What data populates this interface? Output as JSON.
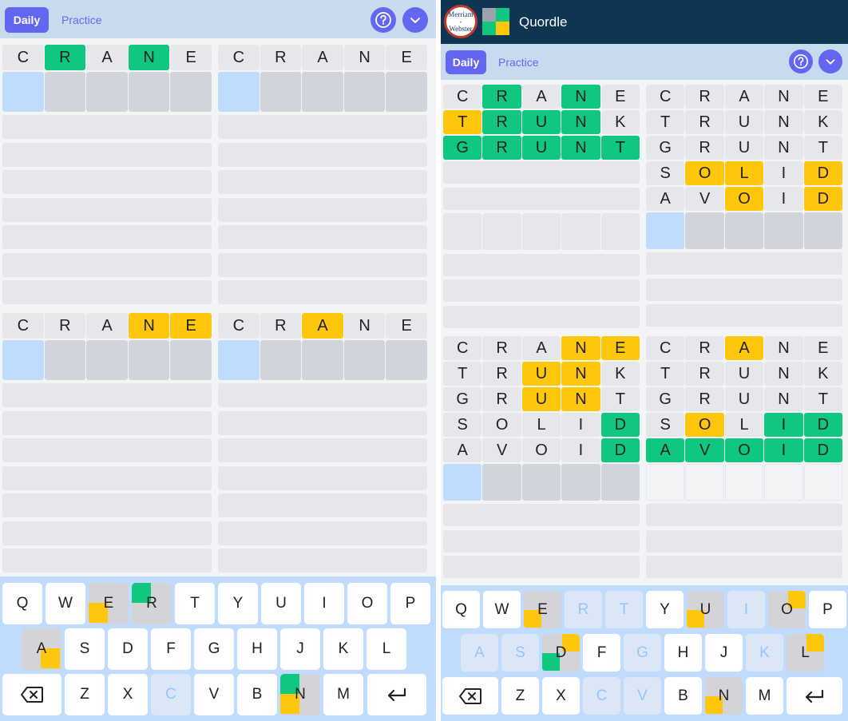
{
  "app": {
    "title": "Quordle",
    "logo_text": "Merriam-Webster"
  },
  "toolbar": {
    "daily_label": "Daily",
    "practice_label": "Practice"
  },
  "icons": {
    "help": "help-circle-icon",
    "menu": "chevron-down-icon",
    "backspace": "backspace-icon",
    "enter": "enter-arrow-icon"
  },
  "colors": {
    "green": "#10c77f",
    "yellow": "#ffc70c",
    "accent": "#6366f1",
    "header": "#0e3552"
  },
  "left": {
    "boards": [
      {
        "rows": [
          {
            "letters": [
              "C",
              "R",
              "A",
              "N",
              "E"
            ],
            "states": [
              "g",
              "G",
              "g",
              "G",
              "g"
            ]
          }
        ]
      },
      {
        "rows": [
          {
            "letters": [
              "C",
              "R",
              "A",
              "N",
              "E"
            ],
            "states": [
              "g",
              "g",
              "g",
              "g",
              "g"
            ]
          }
        ]
      },
      {
        "rows": [
          {
            "letters": [
              "C",
              "R",
              "A",
              "N",
              "E"
            ],
            "states": [
              "g",
              "g",
              "g",
              "Y",
              "Y"
            ]
          }
        ]
      },
      {
        "rows": [
          {
            "letters": [
              "C",
              "R",
              "A",
              "N",
              "E"
            ],
            "states": [
              "g",
              "g",
              "Y",
              "g",
              "g"
            ]
          }
        ]
      }
    ],
    "keyboard": {
      "row1": [
        "Q",
        "W",
        "E",
        "R",
        "T",
        "Y",
        "U",
        "I",
        "O",
        "P"
      ],
      "row2": [
        "A",
        "S",
        "D",
        "F",
        "G",
        "H",
        "J",
        "K",
        "L"
      ],
      "row3": [
        "Z",
        "X",
        "C",
        "V",
        "B",
        "N",
        "M"
      ]
    }
  },
  "right": {
    "boards": [
      {
        "rows": [
          {
            "letters": [
              "C",
              "R",
              "A",
              "N",
              "E"
            ],
            "states": [
              "g",
              "G",
              "g",
              "G",
              "g"
            ]
          },
          {
            "letters": [
              "T",
              "R",
              "U",
              "N",
              "K"
            ],
            "states": [
              "Y",
              "G",
              "G",
              "G",
              "g"
            ]
          },
          {
            "letters": [
              "G",
              "R",
              "U",
              "N",
              "T"
            ],
            "states": [
              "G",
              "G",
              "G",
              "G",
              "G"
            ]
          }
        ],
        "solved": true
      },
      {
        "rows": [
          {
            "letters": [
              "C",
              "R",
              "A",
              "N",
              "E"
            ],
            "states": [
              "g",
              "g",
              "g",
              "g",
              "g"
            ]
          },
          {
            "letters": [
              "T",
              "R",
              "U",
              "N",
              "K"
            ],
            "states": [
              "g",
              "g",
              "g",
              "g",
              "g"
            ]
          },
          {
            "letters": [
              "G",
              "R",
              "U",
              "N",
              "T"
            ],
            "states": [
              "g",
              "g",
              "g",
              "g",
              "g"
            ]
          },
          {
            "letters": [
              "S",
              "O",
              "L",
              "I",
              "D"
            ],
            "states": [
              "g",
              "Y",
              "Y",
              "g",
              "Y"
            ]
          },
          {
            "letters": [
              "A",
              "V",
              "O",
              "I",
              "D"
            ],
            "states": [
              "g",
              "g",
              "Y",
              "g",
              "Y"
            ]
          }
        ]
      },
      {
        "rows": [
          {
            "letters": [
              "C",
              "R",
              "A",
              "N",
              "E"
            ],
            "states": [
              "g",
              "g",
              "g",
              "Y",
              "Y"
            ]
          },
          {
            "letters": [
              "T",
              "R",
              "U",
              "N",
              "K"
            ],
            "states": [
              "g",
              "g",
              "Y",
              "Y",
              "g"
            ]
          },
          {
            "letters": [
              "G",
              "R",
              "U",
              "N",
              "T"
            ],
            "states": [
              "g",
              "g",
              "Y",
              "Y",
              "g"
            ]
          },
          {
            "letters": [
              "S",
              "O",
              "L",
              "I",
              "D"
            ],
            "states": [
              "g",
              "g",
              "g",
              "g",
              "G"
            ]
          },
          {
            "letters": [
              "A",
              "V",
              "O",
              "I",
              "D"
            ],
            "states": [
              "g",
              "g",
              "g",
              "g",
              "G"
            ]
          }
        ]
      },
      {
        "rows": [
          {
            "letters": [
              "C",
              "R",
              "A",
              "N",
              "E"
            ],
            "states": [
              "g",
              "g",
              "Y",
              "g",
              "g"
            ]
          },
          {
            "letters": [
              "T",
              "R",
              "U",
              "N",
              "K"
            ],
            "states": [
              "g",
              "g",
              "g",
              "g",
              "g"
            ]
          },
          {
            "letters": [
              "G",
              "R",
              "U",
              "N",
              "T"
            ],
            "states": [
              "g",
              "g",
              "g",
              "g",
              "g"
            ]
          },
          {
            "letters": [
              "S",
              "O",
              "L",
              "I",
              "D"
            ],
            "states": [
              "g",
              "Y",
              "g",
              "G",
              "G"
            ]
          },
          {
            "letters": [
              "A",
              "V",
              "O",
              "I",
              "D"
            ],
            "states": [
              "G",
              "G",
              "G",
              "G",
              "G"
            ]
          }
        ],
        "solved": true
      }
    ],
    "keyboard": {
      "row1": [
        "Q",
        "W",
        "E",
        "R",
        "T",
        "Y",
        "U",
        "I",
        "O",
        "P"
      ],
      "row2": [
        "A",
        "S",
        "D",
        "F",
        "G",
        "H",
        "J",
        "K",
        "L"
      ],
      "row3": [
        "Z",
        "X",
        "C",
        "V",
        "B",
        "N",
        "M"
      ]
    }
  }
}
